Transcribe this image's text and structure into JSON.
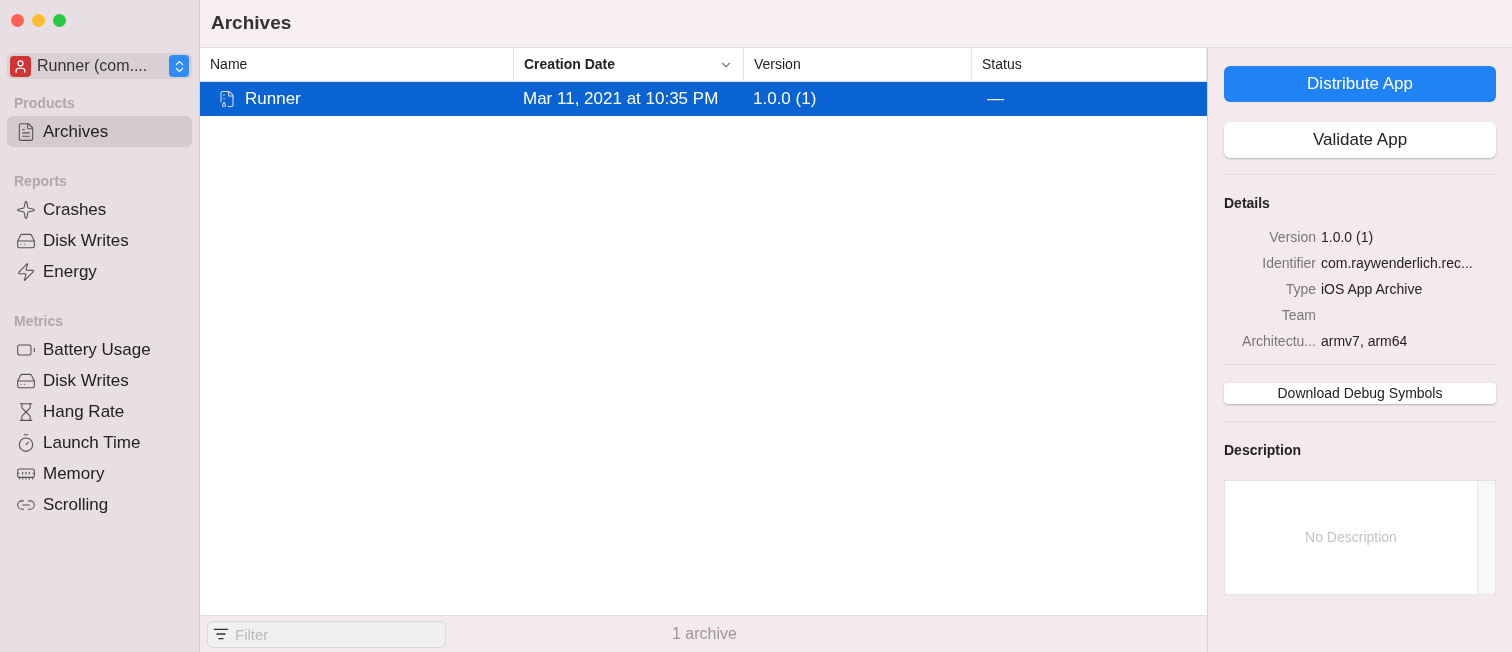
{
  "window": {
    "title": "Archives"
  },
  "scheme": {
    "label": "Runner (com...."
  },
  "sidebar": {
    "sections": [
      {
        "title": "Products",
        "items": [
          {
            "label": "Archives",
            "kind": "archive",
            "selected": true
          }
        ]
      },
      {
        "title": "Reports",
        "items": [
          {
            "label": "Crashes",
            "kind": "crash",
            "selected": false
          },
          {
            "label": "Disk Writes",
            "kind": "disk",
            "selected": false
          },
          {
            "label": "Energy",
            "kind": "energy",
            "selected": false
          }
        ]
      },
      {
        "title": "Metrics",
        "items": [
          {
            "label": "Battery Usage",
            "kind": "battery",
            "selected": false
          },
          {
            "label": "Disk Writes",
            "kind": "disk",
            "selected": false
          },
          {
            "label": "Hang Rate",
            "kind": "hourglass",
            "selected": false
          },
          {
            "label": "Launch Time",
            "kind": "timer",
            "selected": false
          },
          {
            "label": "Memory",
            "kind": "memory",
            "selected": false
          },
          {
            "label": "Scrolling",
            "kind": "scroll",
            "selected": false
          }
        ]
      }
    ]
  },
  "table": {
    "columns": [
      {
        "label": "Name",
        "sorted": false
      },
      {
        "label": "Creation Date",
        "sorted": true
      },
      {
        "label": "Version",
        "sorted": false
      },
      {
        "label": "Status",
        "sorted": false
      }
    ],
    "rows": [
      {
        "name": "Runner",
        "date": "Mar 11, 2021 at 10:35 PM",
        "version": "1.0.0 (1)",
        "status": "—",
        "selected": true
      }
    ]
  },
  "filter": {
    "placeholder": "Filter"
  },
  "status_bar": "1 archive",
  "actions": {
    "primary": "Distribute App",
    "secondary": "Validate App"
  },
  "details": {
    "title": "Details",
    "rows": [
      {
        "label": "Version",
        "value": "1.0.0 (1)"
      },
      {
        "label": "Identifier",
        "value": "com.raywenderlich.rec..."
      },
      {
        "label": "Type",
        "value": "iOS App Archive"
      },
      {
        "label": "Team"
      },
      {
        "label": "Architectu...",
        "value": "armv7, arm64"
      }
    ]
  },
  "debug_button": "Download Debug Symbols",
  "description": {
    "title": "Description",
    "placeholder": "No Description"
  }
}
